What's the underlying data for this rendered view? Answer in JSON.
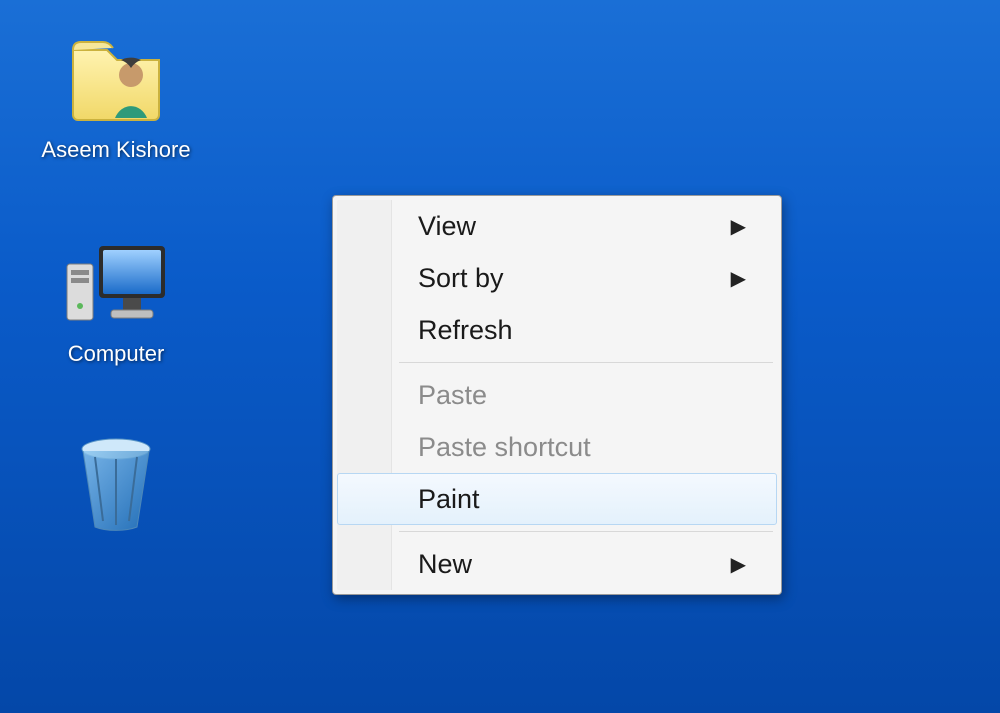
{
  "desktop": {
    "icons": [
      {
        "name": "user-folder",
        "label": "Aseem Kishore"
      },
      {
        "name": "computer",
        "label": "Computer"
      },
      {
        "name": "recycle-bin",
        "label": ""
      }
    ]
  },
  "context_menu": {
    "items": [
      {
        "label": "View",
        "has_submenu": true,
        "enabled": true,
        "hover": false
      },
      {
        "label": "Sort by",
        "has_submenu": true,
        "enabled": true,
        "hover": false
      },
      {
        "label": "Refresh",
        "has_submenu": false,
        "enabled": true,
        "hover": false
      },
      {
        "separator": true
      },
      {
        "label": "Paste",
        "has_submenu": false,
        "enabled": false,
        "hover": false
      },
      {
        "label": "Paste shortcut",
        "has_submenu": false,
        "enabled": false,
        "hover": false
      },
      {
        "label": "Paint",
        "has_submenu": false,
        "enabled": true,
        "hover": true
      },
      {
        "separator": true
      },
      {
        "label": "New",
        "has_submenu": true,
        "enabled": true,
        "hover": false
      }
    ]
  }
}
